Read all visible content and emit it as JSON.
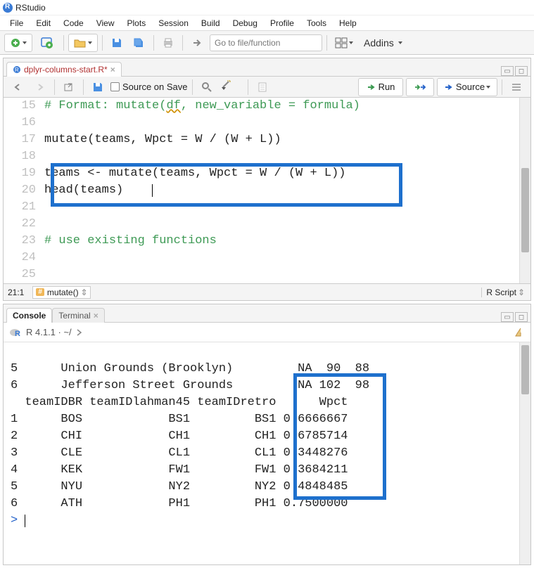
{
  "app": {
    "title": "RStudio"
  },
  "menu": [
    "File",
    "Edit",
    "Code",
    "View",
    "Plots",
    "Session",
    "Build",
    "Debug",
    "Profile",
    "Tools",
    "Help"
  ],
  "toolbar": {
    "gotofile_placeholder": "Go to file/function",
    "addins_label": "Addins"
  },
  "source": {
    "tab_name": "dplyr-columns-start.R*",
    "source_on_save": "Source on Save",
    "run_label": "Run",
    "source_btn": "Source",
    "lines": [
      {
        "num": 15,
        "comment": "# Format: mutate(",
        "wavy": "df",
        "comment2": ", new_variable = formula)"
      },
      {
        "num": 16,
        "code": ""
      },
      {
        "num": 17,
        "code": "mutate(teams, Wpct = W / (W + L))"
      },
      {
        "num": 18,
        "code": ""
      },
      {
        "num": 19,
        "code": "teams <- mutate(teams, Wpct = W / (W + L))"
      },
      {
        "num": 20,
        "code": "head(teams)"
      },
      {
        "num": 21,
        "code": ""
      },
      {
        "num": 22,
        "code": ""
      },
      {
        "num": 23,
        "comment": "# use existing functions"
      },
      {
        "num": 24,
        "code": ""
      },
      {
        "num": 25,
        "code": ""
      }
    ],
    "status_pos": "21:1",
    "status_func": "mutate()",
    "status_lang": "R Script"
  },
  "console_tabs": {
    "console": "Console",
    "terminal": "Terminal"
  },
  "console": {
    "rver": "R 4.1.1 · ~/",
    "lines": [
      "5      Union Grounds (Brooklyn)         NA  90  88",
      "6      Jefferson Street Grounds         NA 102  98",
      "  teamIDBR teamIDlahman45 teamIDretro      Wpct",
      "1      BOS            BS1         BS1 0.6666667",
      "2      CHI            CH1         CH1 0.6785714",
      "3      CLE            CL1         CL1 0.3448276",
      "4      KEK            FW1         FW1 0.3684211",
      "5      NYU            NY2         NY2 0.4848485",
      "6      ATH            PH1         PH1 0.7500000"
    ],
    "prompt": "> "
  }
}
